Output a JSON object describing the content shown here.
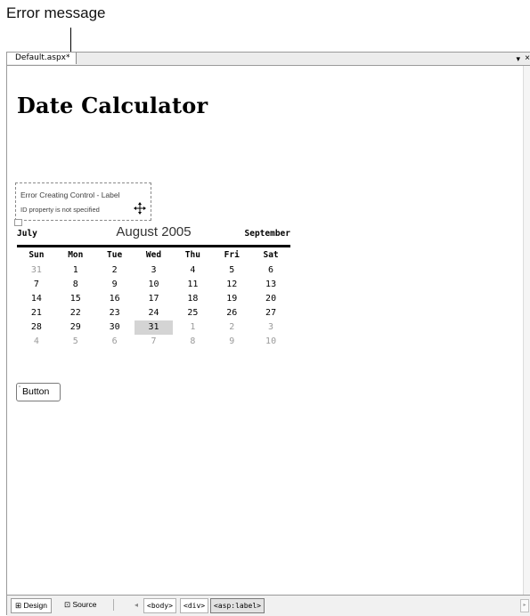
{
  "annotation": {
    "callout_label": "Error message"
  },
  "editor": {
    "tab_title": "Default.aspx*",
    "tab_menu_glyph": "▾",
    "tab_close_glyph": "×"
  },
  "page": {
    "title": "Date Calculator",
    "error_control": {
      "line1": "Error Creating Control - Label",
      "line2": "ID property is not specified",
      "move_icon": "move-icon"
    },
    "calendar": {
      "prev_month": "July",
      "current_month": "August 2005",
      "next_month": "September",
      "day_names": [
        "Sun",
        "Mon",
        "Tue",
        "Wed",
        "Thu",
        "Fri",
        "Sat"
      ],
      "weeks": [
        [
          "31",
          "1",
          "2",
          "3",
          "4",
          "5",
          "6"
        ],
        [
          "7",
          "8",
          "9",
          "10",
          "11",
          "12",
          "13"
        ],
        [
          "14",
          "15",
          "16",
          "17",
          "18",
          "19",
          "20"
        ],
        [
          "21",
          "22",
          "23",
          "24",
          "25",
          "26",
          "27"
        ],
        [
          "28",
          "29",
          "30",
          "31",
          "1",
          "2",
          "3"
        ],
        [
          "4",
          "5",
          "6",
          "7",
          "8",
          "9",
          "10"
        ]
      ],
      "selected_day": "31"
    },
    "button": {
      "label": "Button"
    }
  },
  "status_bar": {
    "design_tab": "Design",
    "source_tab": "Source",
    "breadcrumbs": [
      "<body>",
      "<div>",
      "<asp:label>"
    ],
    "active_breadcrumb": "<asp:label>"
  },
  "colors": {
    "selected_day_bg": "#d4d4d4",
    "other_month_text": "#9a9a9a",
    "calendar_rule": "#000000"
  }
}
